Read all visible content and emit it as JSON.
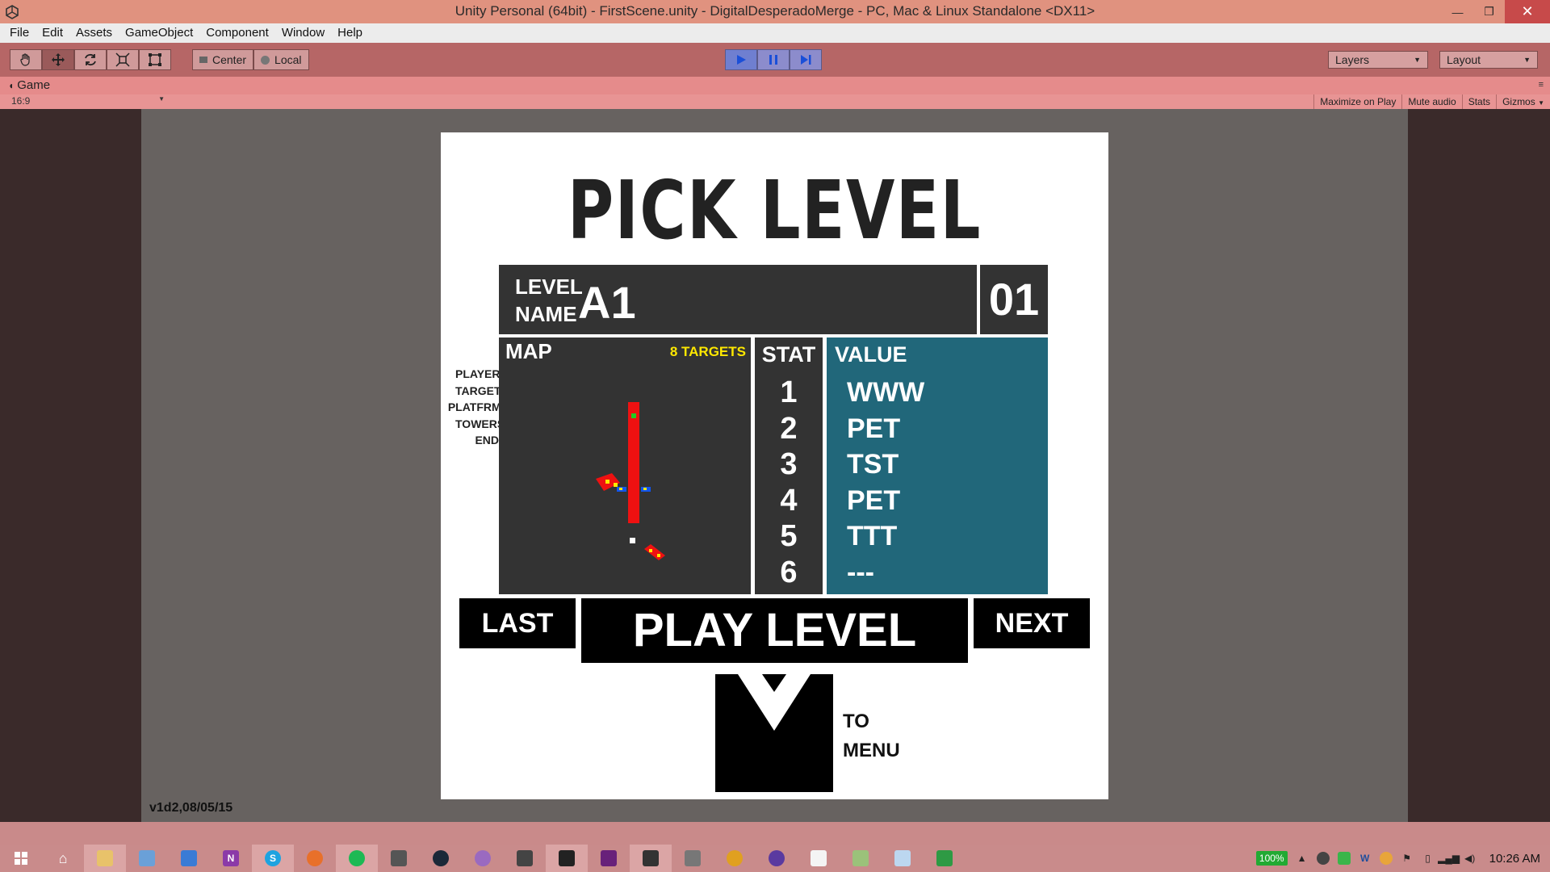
{
  "window": {
    "title": "Unity Personal (64bit) - FirstScene.unity - DigitalDesperadoMerge - PC, Mac & Linux Standalone <DX11>",
    "minimize": "—",
    "maximize": "❐",
    "close": "✕"
  },
  "menu": [
    "File",
    "Edit",
    "Assets",
    "GameObject",
    "Component",
    "Window",
    "Help"
  ],
  "toolbar": {
    "pivot_label": "Center",
    "space_label": "Local",
    "layers_label": "Layers",
    "layout_label": "Layout"
  },
  "game_view": {
    "tab_label": "Game",
    "aspect": "16:9",
    "options": [
      "Maximize on Play",
      "Mute audio",
      "Stats",
      "Gizmos"
    ],
    "version": "v1d2,08/05/15"
  },
  "level_select": {
    "title": "PICK LEVEL",
    "level_label_1": "LEVEL",
    "level_label_2": "NAME",
    "level_name": "A1",
    "level_number": "01",
    "map_title": "MAP",
    "targets_text": "8 TARGETS",
    "legend": [
      {
        "label": "PLAYER",
        "color": "#22cc22"
      },
      {
        "label": "TARGET",
        "color": "#ffe800"
      },
      {
        "label": "PLATFRMS",
        "color": "#ee1111"
      },
      {
        "label": "TOWERS",
        "color": "#1155ee"
      },
      {
        "label": "END",
        "color": "#ffffff"
      }
    ],
    "stat_header": "STAT",
    "stats": [
      "1",
      "2",
      "3",
      "4",
      "5",
      "6"
    ],
    "value_header": "VALUE",
    "values": [
      "WWW",
      "PET",
      "TST",
      "PET",
      "TTT",
      "---"
    ],
    "last_label": "LAST",
    "play_label": "PLAY LEVEL",
    "next_label": "NEXT",
    "menu_label_1": "TO",
    "menu_label_2": "MENU"
  },
  "taskbar": {
    "battery": "100%",
    "clock": "10:26 AM"
  },
  "colors": {
    "titlebar": "#e0927f",
    "toolbar": "#b66666",
    "panel_dark": "#333333",
    "value_teal": "#21677a",
    "target_yellow": "#ffe800"
  }
}
